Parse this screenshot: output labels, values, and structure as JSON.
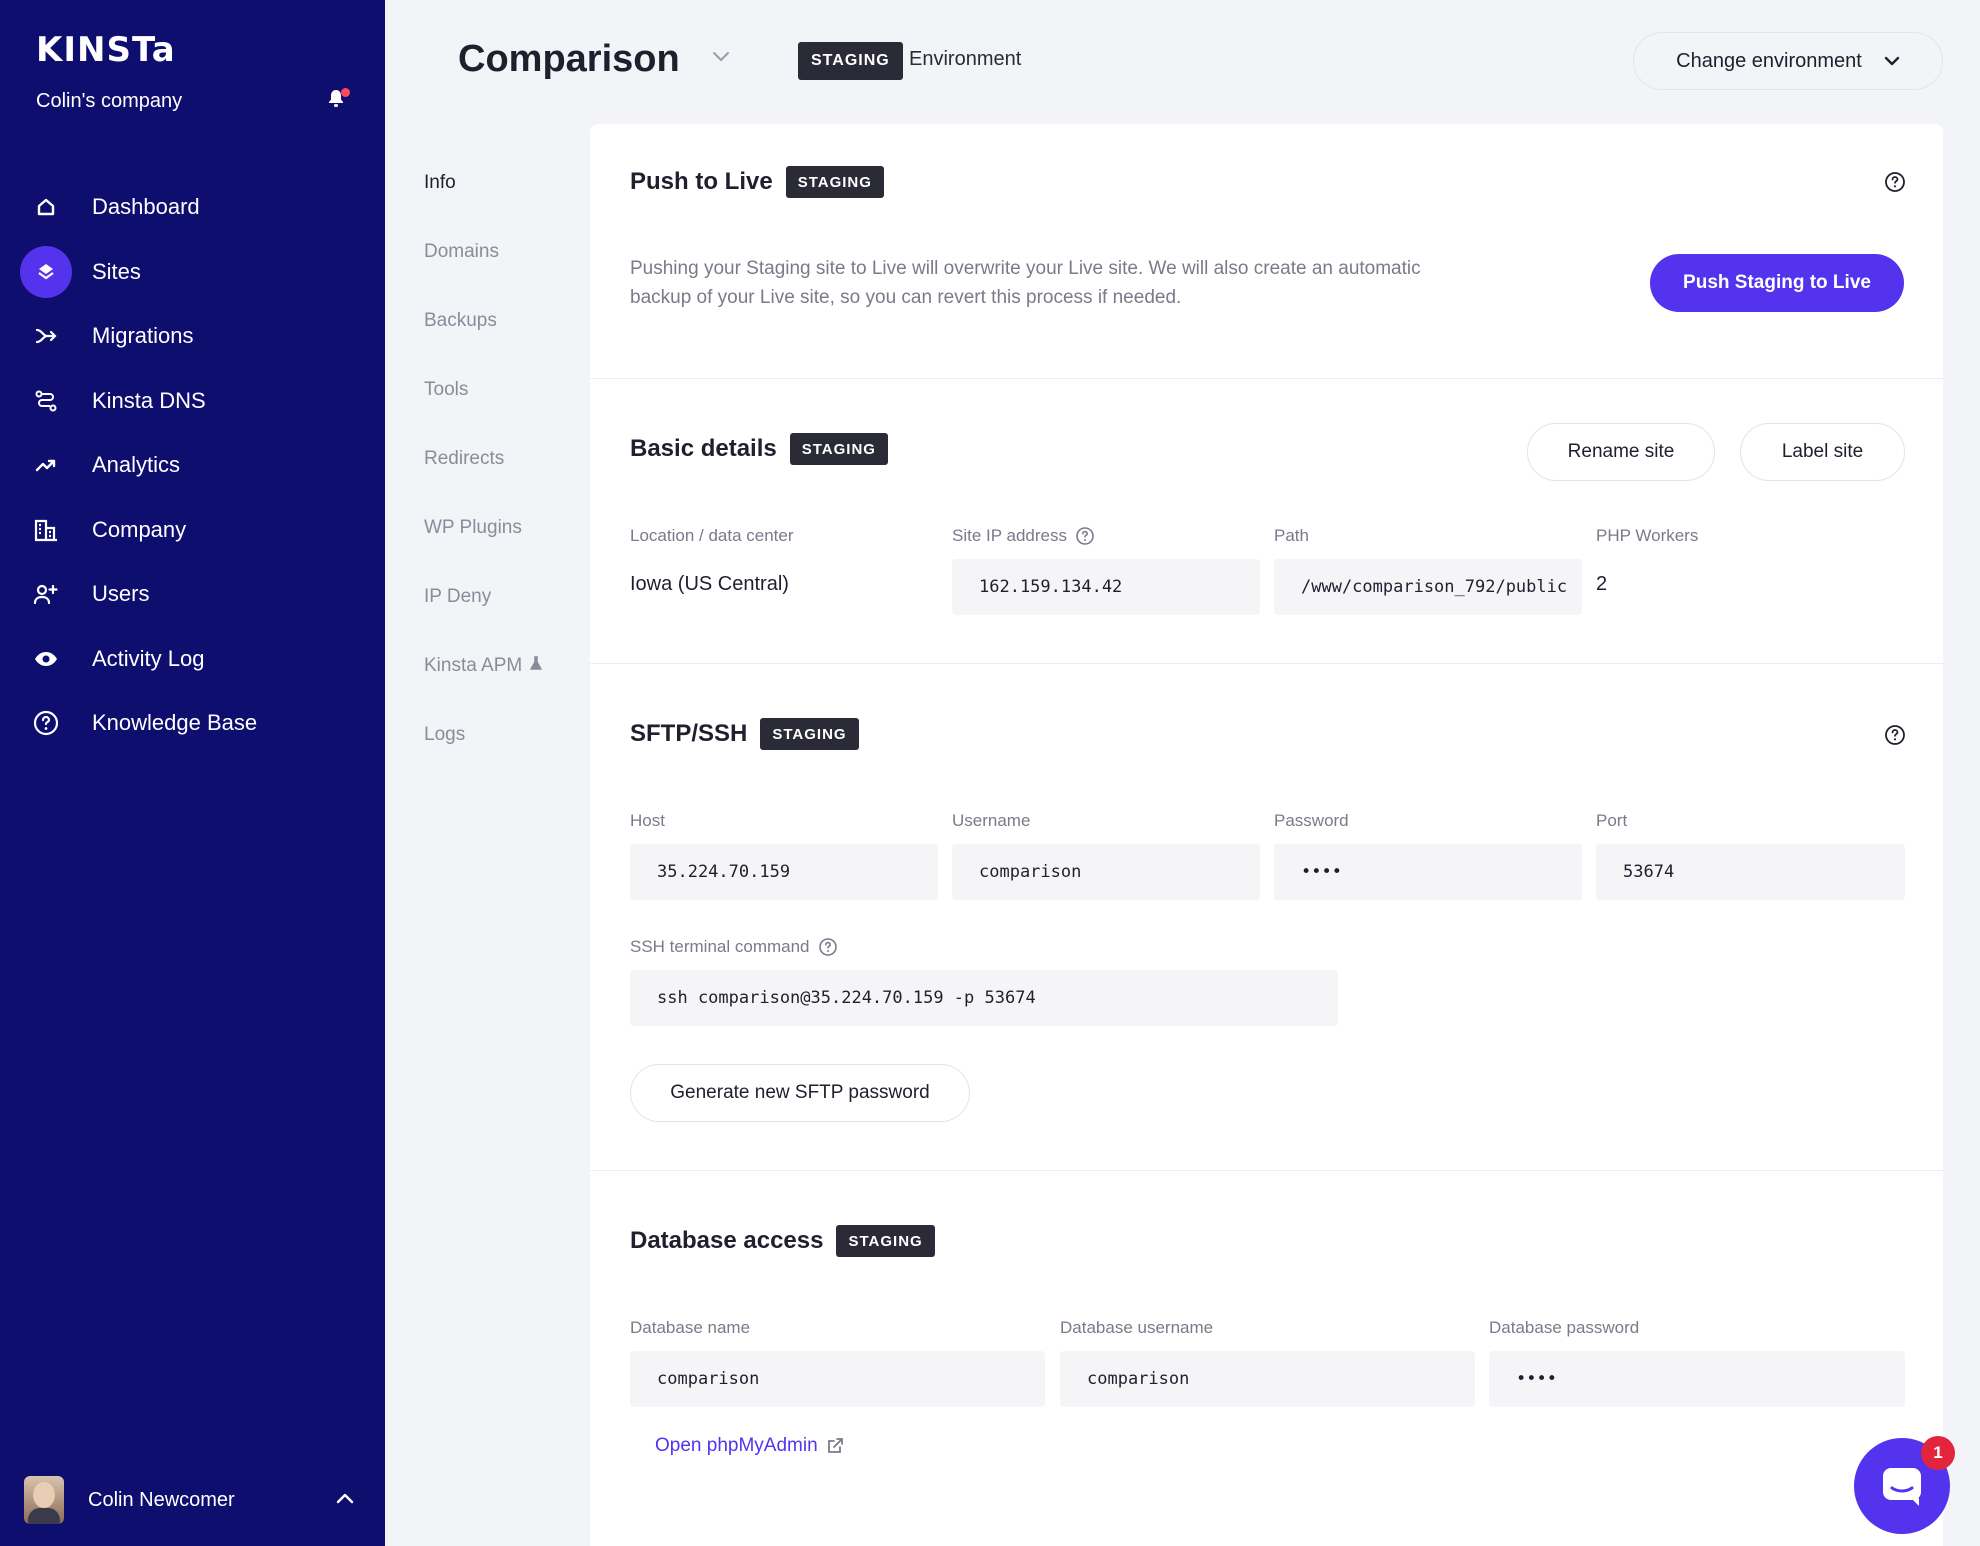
{
  "sidebar": {
    "logo": "KINSTa",
    "company": "Colin's company",
    "items": [
      {
        "label": "Dashboard",
        "icon": "home-icon"
      },
      {
        "label": "Sites",
        "icon": "layers-icon",
        "active": true
      },
      {
        "label": "Migrations",
        "icon": "migrations-icon"
      },
      {
        "label": "Kinsta DNS",
        "icon": "dns-icon"
      },
      {
        "label": "Analytics",
        "icon": "analytics-icon"
      },
      {
        "label": "Company",
        "icon": "building-icon"
      },
      {
        "label": "Users",
        "icon": "add-user-icon"
      },
      {
        "label": "Activity Log",
        "icon": "eye-icon"
      },
      {
        "label": "Knowledge Base",
        "icon": "help-circle-icon"
      }
    ],
    "user_name": "Colin Newcomer"
  },
  "header": {
    "title": "Comparison",
    "env_badge": "STAGING",
    "env_text": "Environment",
    "change_env": "Change environment"
  },
  "subnav": {
    "items": [
      "Info",
      "Domains",
      "Backups",
      "Tools",
      "Redirects",
      "WP Plugins",
      "IP Deny",
      "Kinsta APM",
      "Logs"
    ]
  },
  "push": {
    "title": "Push to Live",
    "badge": "STAGING",
    "desc_line1": "Pushing your Staging site to Live will overwrite your Live site. We will also create an automatic",
    "desc_line2": "backup of your Live site, so you can revert this process if needed.",
    "button": "Push Staging to Live"
  },
  "basic": {
    "title": "Basic details",
    "badge": "STAGING",
    "rename": "Rename site",
    "label": "Label site",
    "location_label": "Location / data center",
    "location_value": "Iowa (US Central)",
    "ip_label": "Site IP address",
    "ip_value": "162.159.134.42",
    "path_label": "Path",
    "path_value": "/www/comparison_792/public",
    "php_label": "PHP Workers",
    "php_value": "2"
  },
  "sftp": {
    "title": "SFTP/SSH",
    "badge": "STAGING",
    "host_label": "Host",
    "host_value": "35.224.70.159",
    "user_label": "Username",
    "user_value": "comparison",
    "pass_label": "Password",
    "pass_value": "••••",
    "port_label": "Port",
    "port_value": "53674",
    "ssh_label": "SSH terminal command",
    "ssh_value": "ssh comparison@35.224.70.159 -p 53674",
    "generate": "Generate new SFTP password"
  },
  "db": {
    "title": "Database access",
    "badge": "STAGING",
    "name_label": "Database name",
    "name_value": "comparison",
    "user_label": "Database username",
    "user_value": "comparison",
    "pass_label": "Database password",
    "pass_value": "••••",
    "link": "Open phpMyAdmin"
  },
  "chat": {
    "count": "1"
  },
  "colors": {
    "sidebar": "#0e0e6f",
    "accent": "#5333ed",
    "badge": "#2b2b38",
    "notification": "#e2243c"
  }
}
